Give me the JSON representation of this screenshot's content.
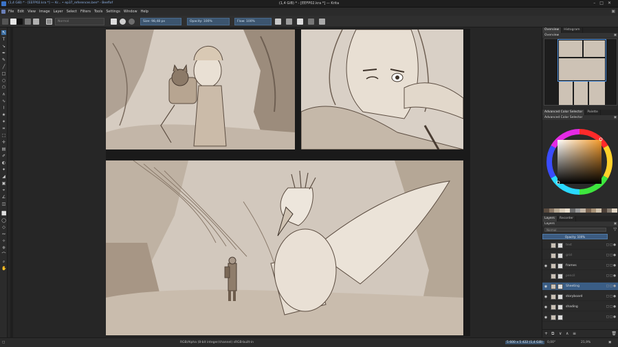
{
  "window": {
    "taskbar_text": "(1,4 GiB) * - [EEFP02.kra *] — Kr... • ep37_references.ben* - Beeflof",
    "title": "(1,4 GiB) * - [EEFP02.kra *] — Krita"
  },
  "menubar": {
    "items": [
      "File",
      "Edit",
      "View",
      "Image",
      "Layer",
      "Select",
      "Filters",
      "Tools",
      "Settings",
      "Window",
      "Help"
    ]
  },
  "toolbar": {
    "blend_mode": "Normal",
    "size": "Size: 98,48 px",
    "opacity": "Opacity: 100%",
    "flow": "Flow: 100%"
  },
  "dock": {
    "top_tabs": [
      "Overview",
      "Histogram"
    ],
    "overview_title": "Overview",
    "color_tabs": [
      "Advanced Color Selector",
      "Palette"
    ],
    "color_title": "Advanced Color Selector",
    "layer_tabs": [
      "Layers",
      "Recorder"
    ],
    "layers_title": "Layers",
    "blend_mode": "Normal",
    "opacity": "Opacity: 100%",
    "palette": [
      "#5a4b3f",
      "#8a7866",
      "#b8a993",
      "#d6c9b6",
      "#e8ddcc",
      "#6b6b6b",
      "#9a9a9a",
      "#c2b5a5",
      "#7a6452",
      "#a89277",
      "#cfc1ab",
      "#4d4038",
      "#857a6e",
      "#e0d4c2"
    ]
  },
  "layers": [
    {
      "name": "text",
      "visible": false,
      "selected": false,
      "dim": true
    },
    {
      "name": "grid",
      "visible": false,
      "selected": false,
      "dim": true
    },
    {
      "name": "frames",
      "visible": true,
      "selected": false,
      "dim": false
    },
    {
      "name": "pencil",
      "visible": false,
      "selected": false,
      "dim": true
    },
    {
      "name": "Sheeting",
      "visible": true,
      "selected": true,
      "dim": false
    },
    {
      "name": "storyboard",
      "visible": true,
      "selected": false,
      "dim": false
    },
    {
      "name": "shading",
      "visible": true,
      "selected": false,
      "dim": false
    },
    {
      "name": "",
      "visible": true,
      "selected": false,
      "dim": false
    }
  ],
  "statusbar": {
    "color_info": "RGB/Alpha (8-bit integer/channel)  sRGB-built-in",
    "image_size": "5 600 x 5 422 (1,4 GiB)",
    "rotation": "0,00°",
    "zoom": "21,9%"
  }
}
